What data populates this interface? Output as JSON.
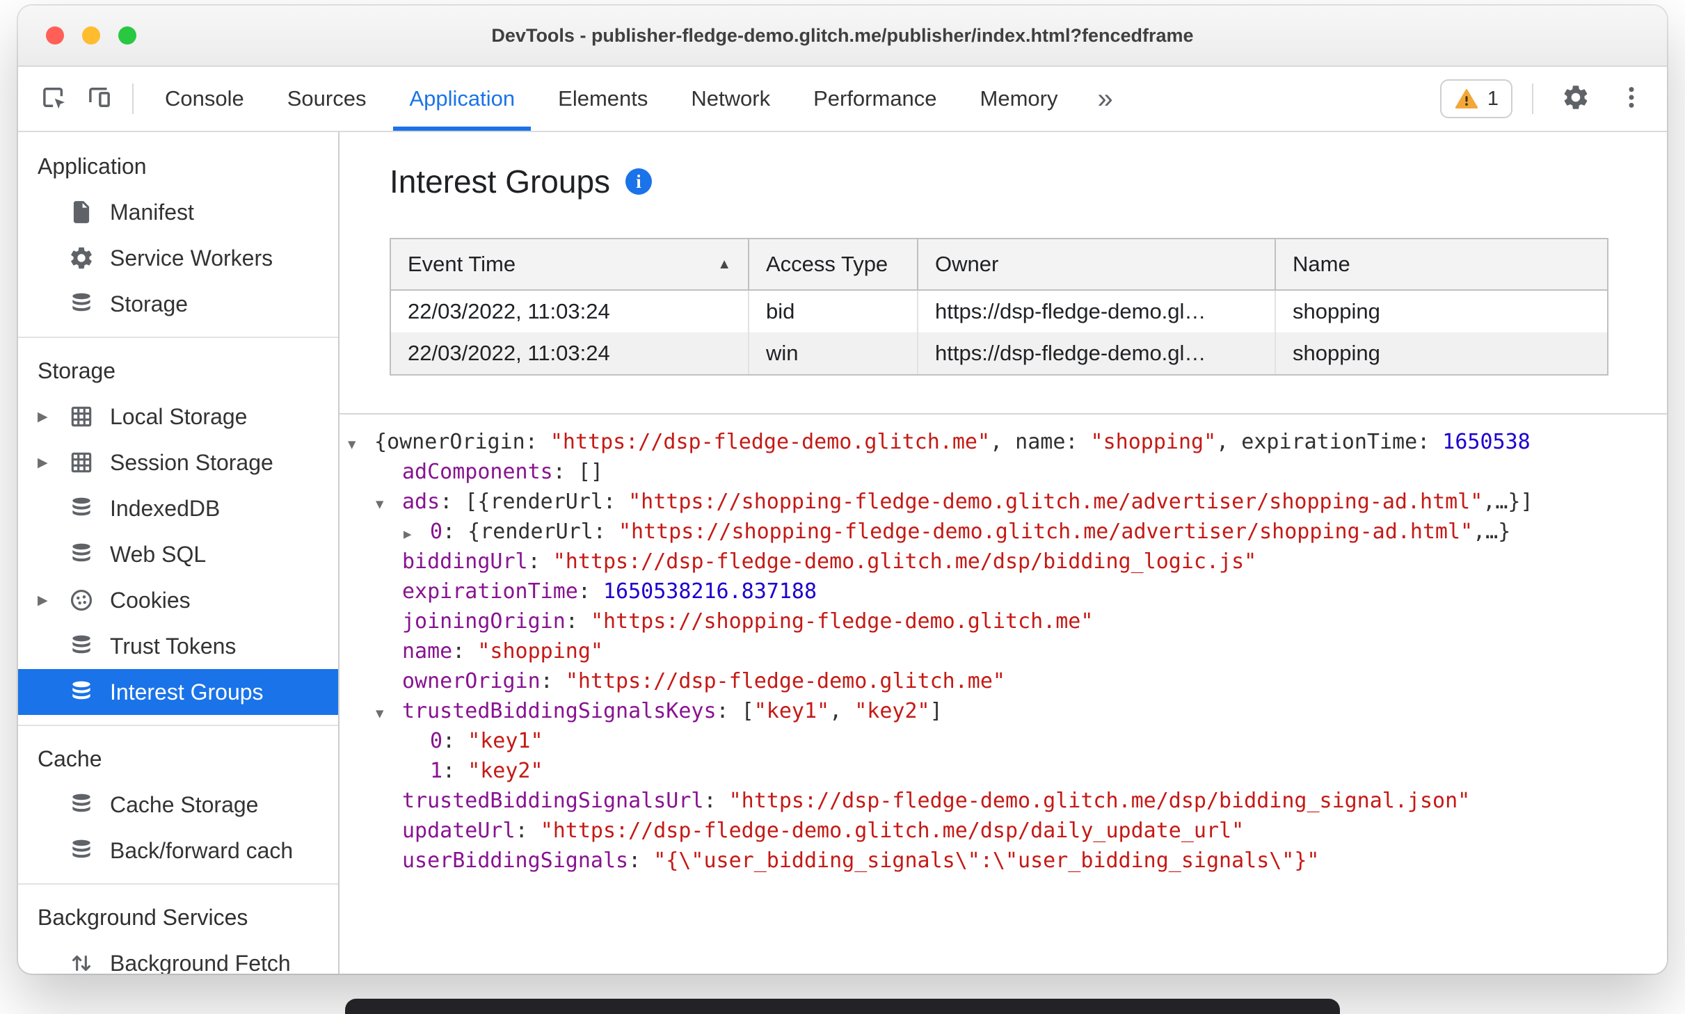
{
  "window": {
    "title": "DevTools - publisher-fledge-demo.glitch.me/publisher/index.html?fencedframe"
  },
  "toolbar": {
    "tabs": [
      {
        "label": "Console"
      },
      {
        "label": "Sources"
      },
      {
        "label": "Application",
        "active": true
      },
      {
        "label": "Elements"
      },
      {
        "label": "Network"
      },
      {
        "label": "Performance"
      },
      {
        "label": "Memory"
      }
    ],
    "more_tabs_symbol": "»",
    "warning_count": "1"
  },
  "sidebar": {
    "sections": [
      {
        "header": "Application",
        "items": [
          {
            "label": "Manifest",
            "icon": "document"
          },
          {
            "label": "Service Workers",
            "icon": "gear"
          },
          {
            "label": "Storage",
            "icon": "database"
          }
        ]
      },
      {
        "header": "Storage",
        "items": [
          {
            "label": "Local Storage",
            "icon": "table",
            "expandable": true
          },
          {
            "label": "Session Storage",
            "icon": "table",
            "expandable": true
          },
          {
            "label": "IndexedDB",
            "icon": "database"
          },
          {
            "label": "Web SQL",
            "icon": "database"
          },
          {
            "label": "Cookies",
            "icon": "cookie",
            "expandable": true
          },
          {
            "label": "Trust Tokens",
            "icon": "database"
          },
          {
            "label": "Interest Groups",
            "icon": "database",
            "selected": true
          }
        ]
      },
      {
        "header": "Cache",
        "items": [
          {
            "label": "Cache Storage",
            "icon": "database"
          },
          {
            "label": "Back/forward cach",
            "icon": "database"
          }
        ]
      },
      {
        "header": "Background Services",
        "items": [
          {
            "label": "Background Fetch",
            "icon": "fetch"
          }
        ]
      }
    ]
  },
  "main": {
    "title": "Interest Groups",
    "info_symbol": "i",
    "table": {
      "columns": [
        {
          "label": "Event Time",
          "sort": "asc"
        },
        {
          "label": "Access Type"
        },
        {
          "label": "Owner"
        },
        {
          "label": "Name"
        }
      ],
      "rows": [
        [
          "22/03/2022, 11:03:24",
          "bid",
          "https://dsp-fledge-demo.gl…",
          "shopping"
        ],
        [
          "22/03/2022, 11:03:24",
          "win",
          "https://dsp-fledge-demo.gl…",
          "shopping"
        ]
      ]
    },
    "tree": {
      "rows": [
        {
          "level": 0,
          "marker": "expanded",
          "segments": [
            {
              "t": "{",
              "c": "plain"
            },
            {
              "t": "ownerOrigin: ",
              "c": "plain"
            },
            {
              "t": "\"https://dsp-fledge-demo.glitch.me\"",
              "c": "str"
            },
            {
              "t": ", ",
              "c": "plain"
            },
            {
              "t": "name: ",
              "c": "plain"
            },
            {
              "t": "\"shopping\"",
              "c": "str"
            },
            {
              "t": ", ",
              "c": "plain"
            },
            {
              "t": "expirationTime: ",
              "c": "plain"
            },
            {
              "t": "1650538",
              "c": "num"
            }
          ]
        },
        {
          "level": 1,
          "marker": null,
          "segments": [
            {
              "t": "adComponents",
              "c": "key"
            },
            {
              "t": ": []",
              "c": "plain"
            }
          ]
        },
        {
          "level": 1,
          "marker": "expanded",
          "segments": [
            {
              "t": "ads",
              "c": "key"
            },
            {
              "t": ": [{",
              "c": "plain"
            },
            {
              "t": "renderUrl: ",
              "c": "plain"
            },
            {
              "t": "\"https://shopping-fledge-demo.glitch.me/advertiser/shopping-ad.html\"",
              "c": "str"
            },
            {
              "t": ",…}]",
              "c": "plain"
            }
          ]
        },
        {
          "level": 2,
          "marker": "collapsed",
          "segments": [
            {
              "t": "0",
              "c": "key"
            },
            {
              "t": ": {",
              "c": "plain"
            },
            {
              "t": "renderUrl: ",
              "c": "plain"
            },
            {
              "t": "\"https://shopping-fledge-demo.glitch.me/advertiser/shopping-ad.html\"",
              "c": "str"
            },
            {
              "t": ",…}",
              "c": "plain"
            }
          ]
        },
        {
          "level": 1,
          "marker": null,
          "segments": [
            {
              "t": "biddingUrl",
              "c": "key"
            },
            {
              "t": ": ",
              "c": "plain"
            },
            {
              "t": "\"https://dsp-fledge-demo.glitch.me/dsp/bidding_logic.js\"",
              "c": "str"
            }
          ]
        },
        {
          "level": 1,
          "marker": null,
          "segments": [
            {
              "t": "expirationTime",
              "c": "key"
            },
            {
              "t": ": ",
              "c": "plain"
            },
            {
              "t": "1650538216.837188",
              "c": "num"
            }
          ]
        },
        {
          "level": 1,
          "marker": null,
          "segments": [
            {
              "t": "joiningOrigin",
              "c": "key"
            },
            {
              "t": ": ",
              "c": "plain"
            },
            {
              "t": "\"https://shopping-fledge-demo.glitch.me\"",
              "c": "str"
            }
          ]
        },
        {
          "level": 1,
          "marker": null,
          "segments": [
            {
              "t": "name",
              "c": "key"
            },
            {
              "t": ": ",
              "c": "plain"
            },
            {
              "t": "\"shopping\"",
              "c": "str"
            }
          ]
        },
        {
          "level": 1,
          "marker": null,
          "segments": [
            {
              "t": "ownerOrigin",
              "c": "key"
            },
            {
              "t": ": ",
              "c": "plain"
            },
            {
              "t": "\"https://dsp-fledge-demo.glitch.me\"",
              "c": "str"
            }
          ]
        },
        {
          "level": 1,
          "marker": "expanded",
          "segments": [
            {
              "t": "trustedBiddingSignalsKeys",
              "c": "key"
            },
            {
              "t": ": [",
              "c": "plain"
            },
            {
              "t": "\"key1\"",
              "c": "str"
            },
            {
              "t": ", ",
              "c": "plain"
            },
            {
              "t": "\"key2\"",
              "c": "str"
            },
            {
              "t": "]",
              "c": "plain"
            }
          ]
        },
        {
          "level": 2,
          "marker": null,
          "segments": [
            {
              "t": "0",
              "c": "key"
            },
            {
              "t": ": ",
              "c": "plain"
            },
            {
              "t": "\"key1\"",
              "c": "str"
            }
          ]
        },
        {
          "level": 2,
          "marker": null,
          "segments": [
            {
              "t": "1",
              "c": "key"
            },
            {
              "t": ": ",
              "c": "plain"
            },
            {
              "t": "\"key2\"",
              "c": "str"
            }
          ]
        },
        {
          "level": 1,
          "marker": null,
          "segments": [
            {
              "t": "trustedBiddingSignalsUrl",
              "c": "key"
            },
            {
              "t": ": ",
              "c": "plain"
            },
            {
              "t": "\"https://dsp-fledge-demo.glitch.me/dsp/bidding_signal.json\"",
              "c": "str"
            }
          ]
        },
        {
          "level": 1,
          "marker": null,
          "segments": [
            {
              "t": "updateUrl",
              "c": "key"
            },
            {
              "t": ": ",
              "c": "plain"
            },
            {
              "t": "\"https://dsp-fledge-demo.glitch.me/dsp/daily_update_url\"",
              "c": "str"
            }
          ]
        },
        {
          "level": 1,
          "marker": null,
          "segments": [
            {
              "t": "userBiddingSignals",
              "c": "key"
            },
            {
              "t": ": ",
              "c": "plain"
            },
            {
              "t": "\"{\\\"user_bidding_signals\\\":\\\"user_bidding_signals\\\"}\"",
              "c": "str"
            }
          ]
        }
      ]
    }
  },
  "colors": {
    "accent": "#1a73e8",
    "json_key": "#881391",
    "json_string": "#c41a16",
    "json_number": "#1c00cf",
    "warning": "#f2a73b",
    "traffic_close": "#ff5f57",
    "traffic_minimize": "#febc2e",
    "traffic_zoom": "#28c840"
  }
}
